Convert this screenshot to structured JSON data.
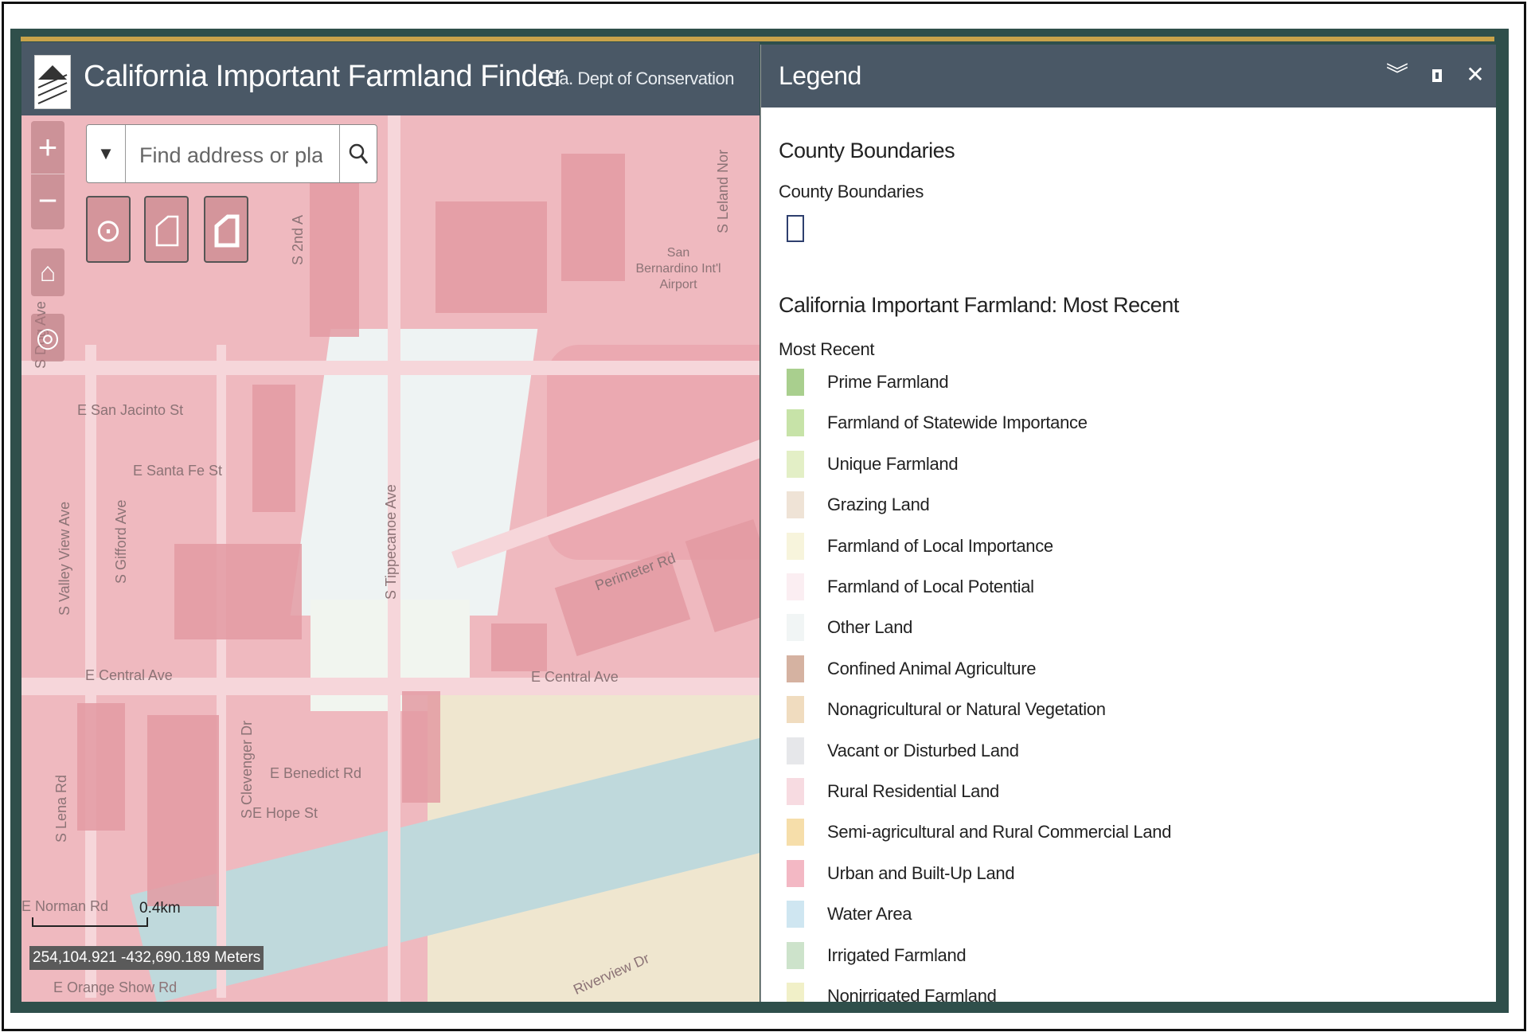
{
  "header": {
    "app_title": "California Important Farmland Finder",
    "app_subtitle": "Ca. Dept of Conservation"
  },
  "map": {
    "search": {
      "placeholder": "Find address or place"
    },
    "zoom_in_label": "+",
    "zoom_out_label": "−",
    "scale_label": "0.4km",
    "coordinates": "254,104.921 -432,690.189 Meters",
    "street_labels": [
      "E San Jacinto St",
      "E Santa Fe St",
      "S Valley View Ave",
      "S Gifford Ave",
      "S 2nd A",
      "S Leland Nor",
      "San Bernardino Int'l Airport",
      "S Tippecanoe Ave",
      "Perimeter Rd",
      "E Central Ave",
      "E Central Ave",
      "S Clevenger Dr",
      "E Benedict Rd",
      "E Hope St",
      "S Lena Rd",
      "E Norman Rd",
      "E Orange Show Rd",
      "Riverview Dr",
      "S Dog Ave"
    ]
  },
  "legend": {
    "title": "Legend",
    "sections": [
      {
        "title": "County Boundaries",
        "layer": "County Boundaries"
      },
      {
        "title": "California Important Farmland: Most Recent",
        "layer": "Most Recent"
      }
    ],
    "items": [
      {
        "label": "Prime Farmland",
        "color": "#a9cf8e"
      },
      {
        "label": "Farmland of Statewide Importance",
        "color": "#c7e3a8"
      },
      {
        "label": "Unique Farmland",
        "color": "#e3efc6"
      },
      {
        "label": "Grazing Land",
        "color": "#efe3d6"
      },
      {
        "label": "Farmland of Local Importance",
        "color": "#f7f4dc"
      },
      {
        "label": "Farmland of Local Potential",
        "color": "#fbeef2"
      },
      {
        "label": "Other Land",
        "color": "#f1f5f5"
      },
      {
        "label": "Confined Animal Agriculture",
        "color": "#d5b2a1"
      },
      {
        "label": "Nonagricultural or Natural Vegetation",
        "color": "#f0dcbf"
      },
      {
        "label": "Vacant or Disturbed Land",
        "color": "#e6e7ea"
      },
      {
        "label": "Rural Residential Land",
        "color": "#f7dbe1"
      },
      {
        "label": "Semi-agricultural and Rural Commercial Land",
        "color": "#f6deaa"
      },
      {
        "label": "Urban and Built-Up Land",
        "color": "#f3b8c4"
      },
      {
        "label": "Water Area",
        "color": "#cfe6f1"
      },
      {
        "label": "Irrigated Farmland",
        "color": "#cde3cb"
      },
      {
        "label": "Nonirrigated Farmland",
        "color": "#f1f0c8"
      }
    ]
  },
  "icons": {
    "collapse": "chevrons-down-icon",
    "maximize": "maximize-icon",
    "close": "close-icon",
    "search": "search-icon",
    "home": "home-icon",
    "locate": "locate-icon",
    "tools": [
      "circle-draw-icon",
      "polygon-draw-icon",
      "polygon-fill-icon"
    ]
  }
}
